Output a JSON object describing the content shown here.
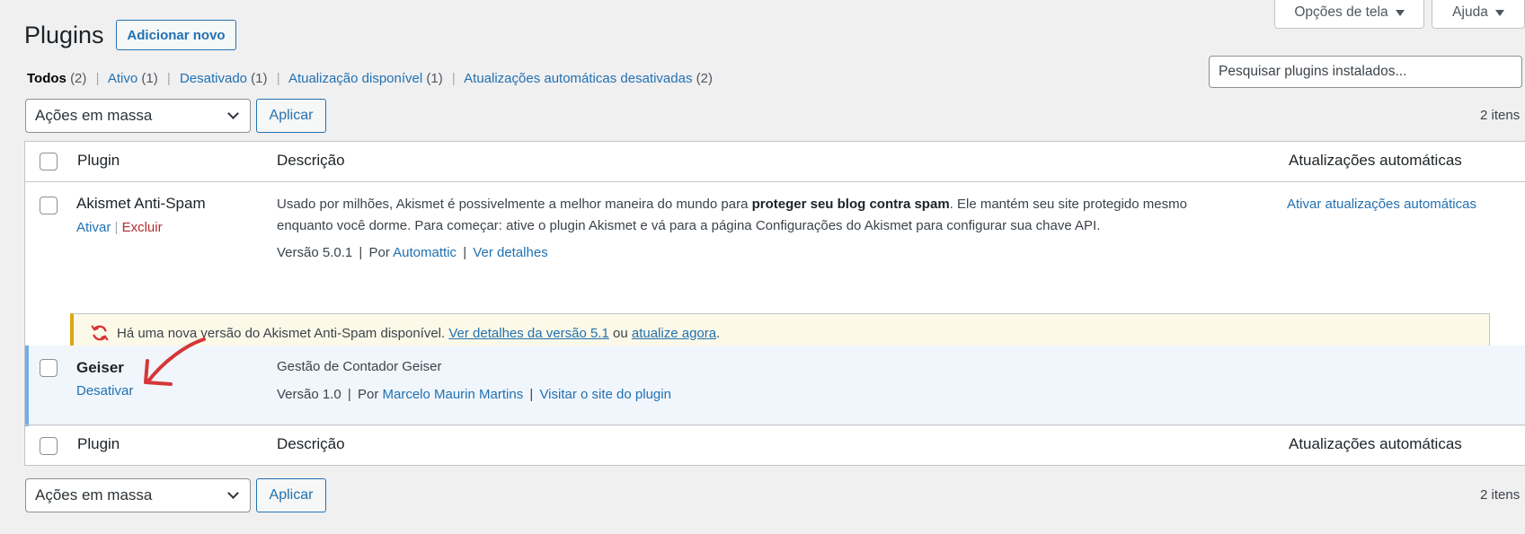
{
  "screen_meta": {
    "screen_options_label": "Opções de tela",
    "help_label": "Ajuda"
  },
  "header": {
    "title": "Plugins",
    "add_new_label": "Adicionar novo"
  },
  "filters": [
    {
      "label": "Todos",
      "count": "(2)"
    },
    {
      "label": "Ativo",
      "count": "(1)"
    },
    {
      "label": "Desativado",
      "count": "(1)"
    },
    {
      "label": "Atualização disponível",
      "count": "(1)"
    },
    {
      "label": "Atualizações automáticas desativadas",
      "count": "(2)"
    }
  ],
  "search": {
    "placeholder": "Pesquisar plugins instalados..."
  },
  "bulk": {
    "selected": "Ações em massa",
    "apply_label": "Aplicar",
    "items_count": "2 itens"
  },
  "table": {
    "columns": {
      "plugin": "Plugin",
      "description": "Descrição",
      "auto_updates": "Atualizações automáticas"
    },
    "rows": [
      {
        "name": "Akismet Anti-Spam",
        "actions": {
          "activate": "Ativar",
          "delete": "Excluir"
        },
        "description_pre": "Usado por milhões, Akismet é possivelmente a melhor maneira do mundo para ",
        "description_bold": "proteger seu blog contra spam",
        "description_post": ". Ele mantém seu site protegido mesmo enquanto você dorme. Para começar: ative o plugin Akismet e vá para a página Configurações do Akismet para configurar sua chave API.",
        "version": "Versão 5.0.1",
        "by": "Por",
        "author": "Automattic",
        "details_link": "Ver detalhes",
        "auto_update_link": "Ativar atualizações automáticas",
        "update_notice": {
          "text_pre": "Há uma nova versão do Akismet Anti-Spam disponível. ",
          "details_link": "Ver detalhes da versão 5.1",
          "text_mid": " ou ",
          "update_link": "atualize agora",
          "text_post": "."
        }
      },
      {
        "name": "Geiser",
        "actions": {
          "deactivate": "Desativar"
        },
        "description": "Gestão de Contador Geiser",
        "version": "Versão 1.0",
        "by": "Por",
        "author": "Marcelo Maurin Martins",
        "site_link": "Visitar o site do plugin"
      }
    ]
  },
  "colors": {
    "link": "#2271b1",
    "delete": "#b32d2e",
    "active_row_bg": "#f0f6fc",
    "active_row_border": "#72aee6",
    "notice_border": "#dba617",
    "annotation_red": "#d63638"
  }
}
